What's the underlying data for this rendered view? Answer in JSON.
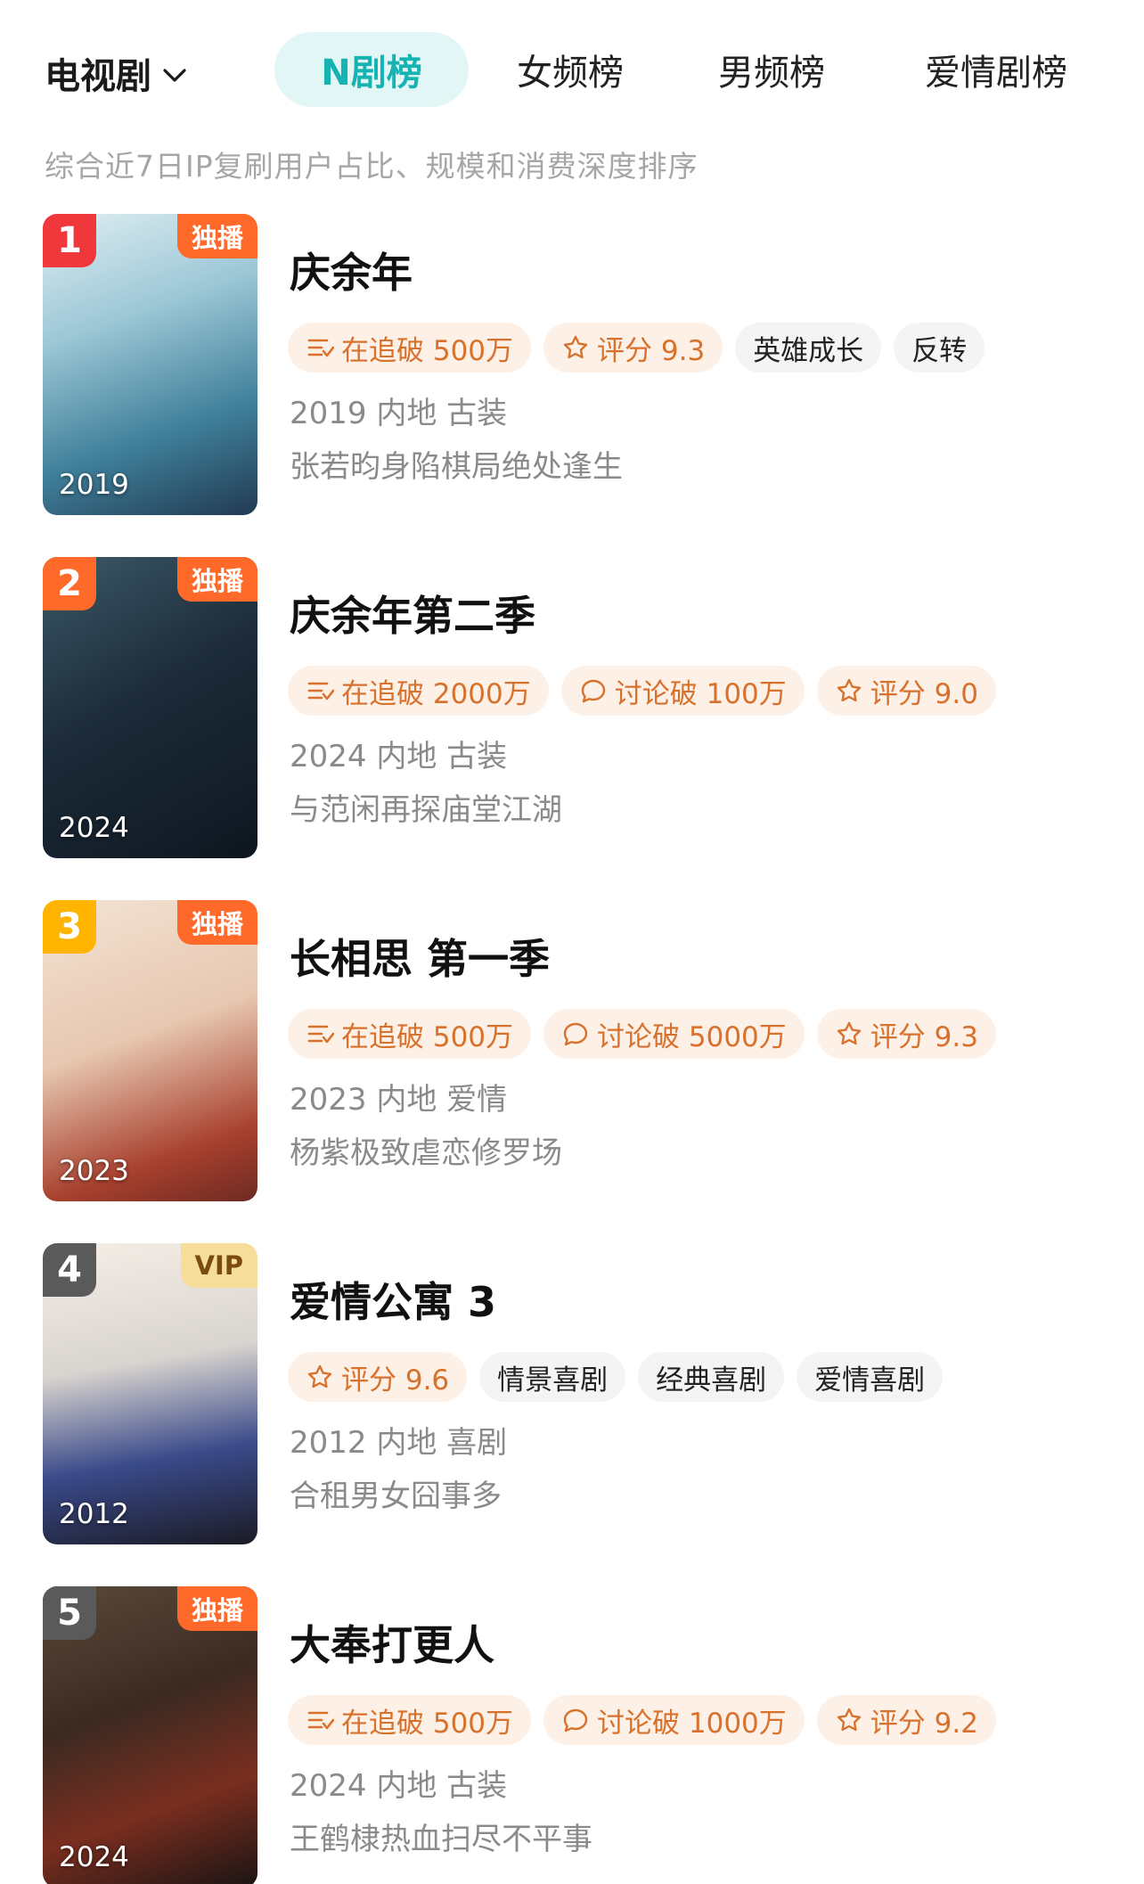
{
  "header": {
    "category": "电视剧",
    "tabs": [
      {
        "label": "N剧榜",
        "active": true
      },
      {
        "label": "女频榜",
        "active": false
      },
      {
        "label": "男频榜",
        "active": false
      },
      {
        "label": "爱情剧榜",
        "active": false
      }
    ]
  },
  "subtitle": "综合近7日IP复刷用户占比、规模和消费深度排序",
  "colors": {
    "accent": "#17b3b3",
    "hot_tag_text": "#d8712c",
    "exclusive": "#ff6a2a"
  },
  "items": [
    {
      "rank": "1",
      "rank_color": "#f0383c",
      "badge": "独播",
      "badge_type": "exclusive",
      "year": "2019",
      "title": "庆余年",
      "tags": [
        {
          "icon": "list-icon",
          "text": "在追破 500万",
          "style": "hot"
        },
        {
          "icon": "star-icon",
          "text": "评分 9.3",
          "style": "hot"
        },
        {
          "icon": "",
          "text": "英雄成长",
          "style": "plain"
        },
        {
          "icon": "",
          "text": "反转",
          "style": "plain"
        }
      ],
      "meta": "2019 内地 古装",
      "desc": "张若昀身陷棋局绝处逢生"
    },
    {
      "rank": "2",
      "rank_color": "#ff6a2a",
      "badge": "独播",
      "badge_type": "exclusive",
      "year": "2024",
      "title": "庆余年第二季",
      "tags": [
        {
          "icon": "list-icon",
          "text": "在追破 2000万",
          "style": "hot"
        },
        {
          "icon": "chat-icon",
          "text": "讨论破 100万",
          "style": "hot"
        },
        {
          "icon": "star-icon",
          "text": "评分 9.0",
          "style": "hot"
        }
      ],
      "meta": "2024 内地 古装",
      "desc": "与范闲再探庙堂江湖"
    },
    {
      "rank": "3",
      "rank_color": "#ffb400",
      "badge": "独播",
      "badge_type": "exclusive",
      "year": "2023",
      "title": "长相思 第一季",
      "tags": [
        {
          "icon": "list-icon",
          "text": "在追破 500万",
          "style": "hot"
        },
        {
          "icon": "chat-icon",
          "text": "讨论破 5000万",
          "style": "hot"
        },
        {
          "icon": "star-icon",
          "text": "评分 9.3",
          "style": "hot"
        }
      ],
      "meta": "2023 内地 爱情",
      "desc": "杨紫极致虐恋修罗场"
    },
    {
      "rank": "4",
      "rank_color": "#5a5a5a",
      "badge": "VIP",
      "badge_type": "vip",
      "year": "2012",
      "title": "爱情公寓 3",
      "tags": [
        {
          "icon": "star-icon",
          "text": "评分 9.6",
          "style": "hot"
        },
        {
          "icon": "",
          "text": "情景喜剧",
          "style": "plain"
        },
        {
          "icon": "",
          "text": "经典喜剧",
          "style": "plain"
        },
        {
          "icon": "",
          "text": "爱情喜剧",
          "style": "plain"
        }
      ],
      "meta": "2012 内地 喜剧",
      "desc": "合租男女囧事多"
    },
    {
      "rank": "5",
      "rank_color": "#5a5a5a",
      "badge": "独播",
      "badge_type": "exclusive",
      "year": "2024",
      "title": "大奉打更人",
      "tags": [
        {
          "icon": "list-icon",
          "text": "在追破 500万",
          "style": "hot"
        },
        {
          "icon": "chat-icon",
          "text": "讨论破 1000万",
          "style": "hot"
        },
        {
          "icon": "star-icon",
          "text": "评分 9.2",
          "style": "hot"
        }
      ],
      "meta": "2024 内地 古装",
      "desc": "王鹤棣热血扫尽不平事"
    }
  ]
}
